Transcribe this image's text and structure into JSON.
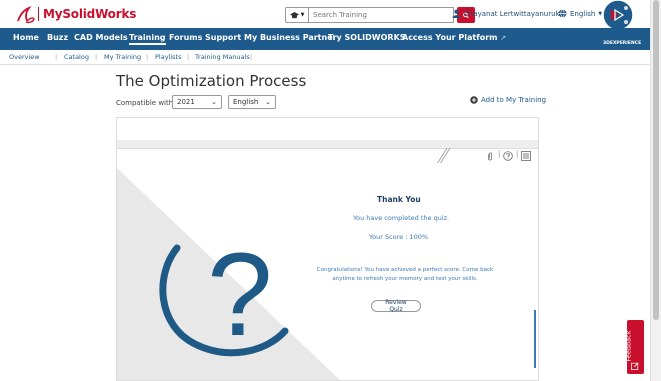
{
  "header": {
    "brand": "MySolidWorks",
    "search_placeholder": "Search Training",
    "user_name": "Chayanat Lertwittayanuruk",
    "language": "English"
  },
  "nav": {
    "items": [
      "Home",
      "Buzz",
      "CAD Models",
      "Training",
      "Forums",
      "Support",
      "My Business Partner",
      "Try SOLIDWORKS",
      "Access Your Platform"
    ],
    "active": "Training",
    "platform_label": "3DEXPERIENCE"
  },
  "subnav": {
    "items": [
      "Overview",
      "Catalog",
      "My Training",
      "Playlists",
      "Training Manuals"
    ]
  },
  "page": {
    "title": "The Optimization Process",
    "compat_label": "Compatible with",
    "version": "2021",
    "language": "English",
    "add_label": "Add to My Training"
  },
  "quiz": {
    "thank_you": "Thank You",
    "completed": "You have completed the quiz.",
    "score_label": "Your Score :",
    "score_value": "100%",
    "congrats": "Congratulations! You have achieved a perfect score. Come back anytime to refresh your memory and test your skills.",
    "review_button": "Review Quiz"
  },
  "feedback": {
    "label": "Feedback"
  },
  "colors": {
    "brand_red": "#c8102e",
    "nav_blue": "#1e5a8c",
    "quiz_blue": "#1e3f66"
  }
}
